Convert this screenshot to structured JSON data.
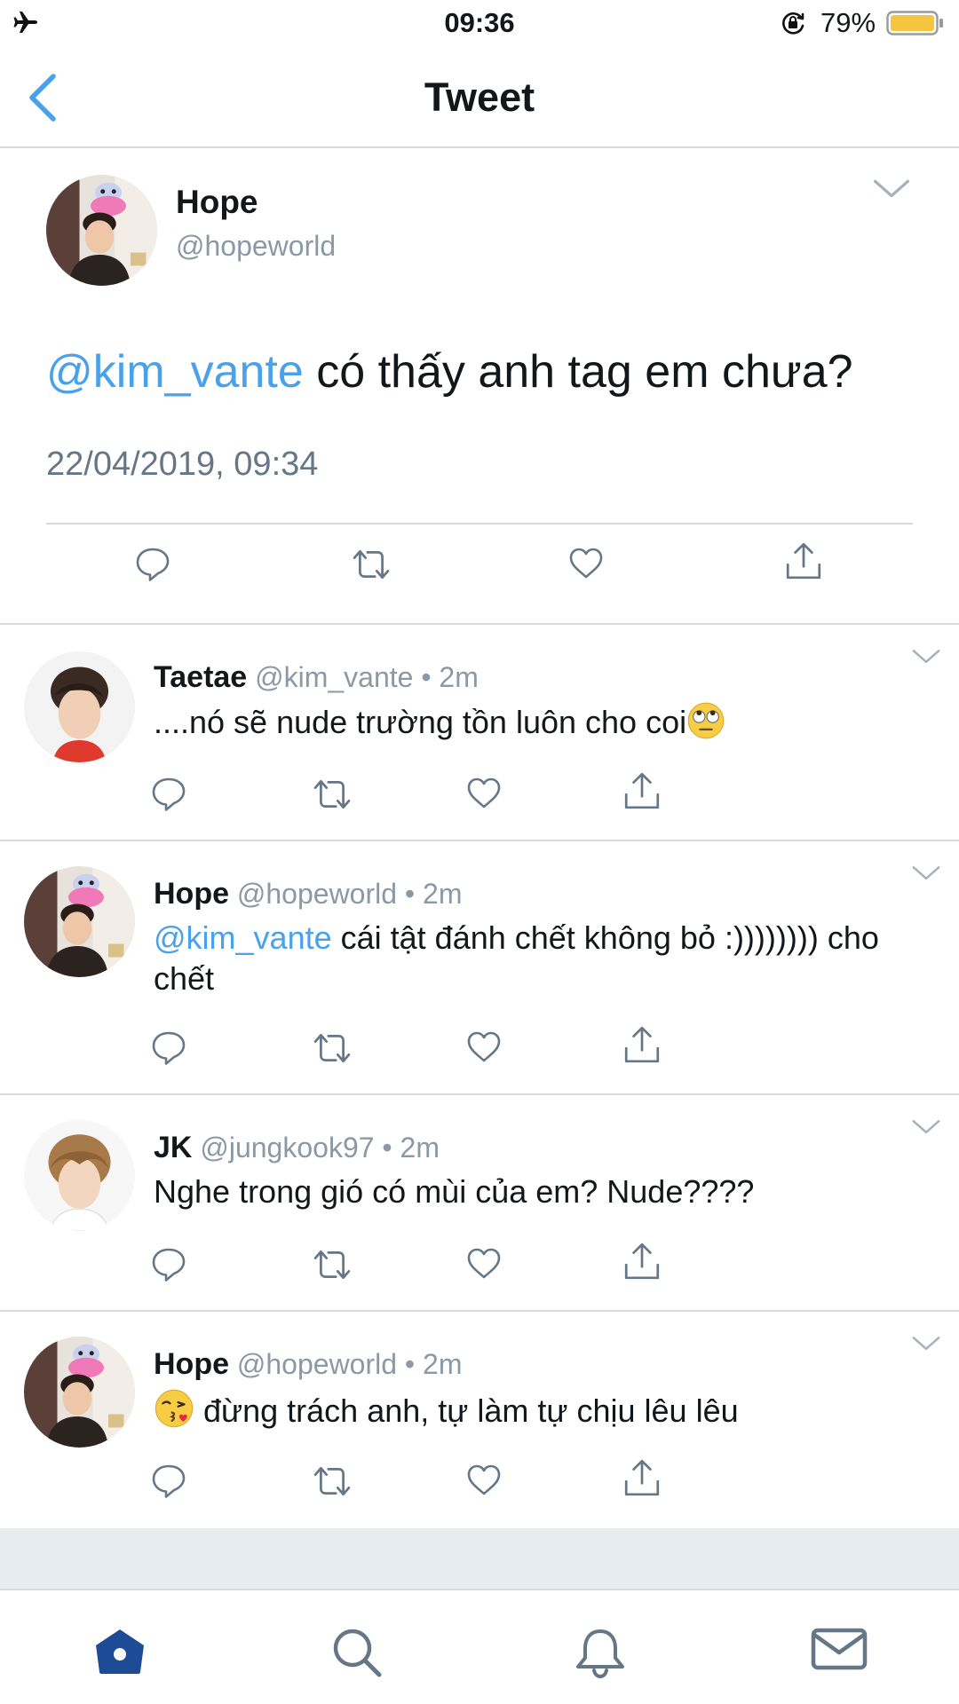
{
  "status_bar": {
    "time": "09:36",
    "battery_percent": "79%",
    "battery_level": 0.79,
    "icons": [
      "airplane-icon",
      "rotation-lock-icon",
      "battery-icon"
    ]
  },
  "nav": {
    "title": "Tweet",
    "back_icon": "chevron-left-icon"
  },
  "main_tweet": {
    "name": "Hope",
    "handle": "@hopeworld",
    "mention": "@kim_vante",
    "text": " có thấy anh tag em chưa?",
    "date": "22/04/2019, 09:34"
  },
  "replies": [
    {
      "name": "Taetae",
      "handle": "@kim_vante",
      "dot": "•",
      "time": "2m",
      "mention": "",
      "text": "....nó sẽ nude trường tồn luôn cho coi",
      "emoji": "eye-roll-emoji"
    },
    {
      "name": "Hope",
      "handle": "@hopeworld",
      "dot": "•",
      "time": "2m",
      "mention": "@kim_vante",
      "text": " cái tật đánh chết không bỏ :)))))))) cho chết"
    },
    {
      "name": "JK",
      "handle": "@jungkook97",
      "dot": "•",
      "time": "2m",
      "mention": "",
      "text": "Nghe trong gió có mùi của em? Nude????"
    },
    {
      "name": "Hope",
      "handle": "@hopeworld",
      "dot": "•",
      "time": "2m",
      "mention": "",
      "text": " đừng trách anh, tự làm tự chịu lêu lêu",
      "emoji": "kissing-heart-emoji"
    }
  ],
  "actions": [
    "reply-icon",
    "retweet-icon",
    "like-icon",
    "share-icon"
  ],
  "tab_bar": [
    "home-icon",
    "search-icon",
    "notifications-icon",
    "messages-icon"
  ],
  "colors": {
    "accent": "#4aa1eb",
    "tab_active": "#1e4b96",
    "secondary_text": "#8b98a5",
    "divider": "#d6dbdf"
  }
}
